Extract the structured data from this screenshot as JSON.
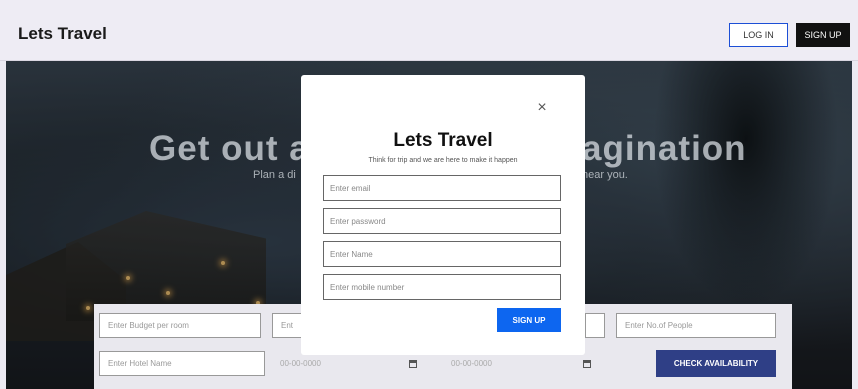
{
  "header": {
    "brand": "Lets Travel",
    "login_label": "LOG IN",
    "signup_label": "SIGN UP"
  },
  "hero": {
    "title_left": "Get out a",
    "title_right": "agination",
    "sub_left": "Plan a di",
    "sub_right": "near you."
  },
  "search": {
    "budget_placeholder": "Enter Budget per room",
    "second_placeholder": "Ent",
    "people_placeholder": "Enter No.of People",
    "hotel_placeholder": "Enter Hotel Name",
    "date1": "00-00-0000",
    "date2": "00-00-0000",
    "check_label": "CHECK AVAILABILITY"
  },
  "modal": {
    "close_label": "×",
    "title": "Lets Travel",
    "subtitle": "Think for trip and we are here to make it happen",
    "email_placeholder": "Enter email",
    "password_placeholder": "Enter password",
    "name_placeholder": "Enter Name",
    "mobile_placeholder": "Enter mobile number",
    "signup_label": "SIGN UP"
  }
}
